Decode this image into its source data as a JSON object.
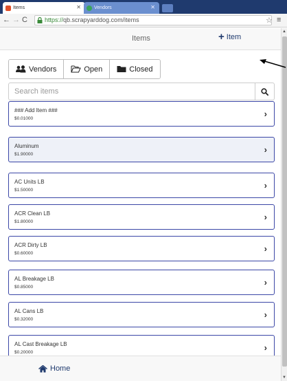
{
  "browser": {
    "tabs": [
      {
        "title": "Items"
      },
      {
        "title": "Vendors"
      }
    ],
    "url_scheme": "https://",
    "url_rest": "qb.scrapyarddog.com/items"
  },
  "header": {
    "title": "Items",
    "add_label": "Item"
  },
  "filters": {
    "vendors_label": "Vendors",
    "open_label": "Open",
    "closed_label": "Closed"
  },
  "search": {
    "placeholder": "Search items"
  },
  "items": [
    {
      "name": "### Add Item ###",
      "price": "$0.01000"
    },
    {
      "name": "Aluminum",
      "price": "$1.90000"
    },
    {
      "name": "AC Units LB",
      "price": "$1.50000"
    },
    {
      "name": "ACR Clean LB",
      "price": "$1.80000"
    },
    {
      "name": "ACR Dirty LB",
      "price": "$0.60000"
    },
    {
      "name": "AL Breakage LB",
      "price": "$0.85000"
    },
    {
      "name": "AL Cans LB",
      "price": "$0.32000"
    },
    {
      "name": "AL Cast Breakage LB",
      "price": "$0.20000"
    }
  ],
  "footer": {
    "home_label": "Home"
  },
  "colors": {
    "accent": "#1f3a6e",
    "item_border": "#3a46a6",
    "highlight_row": "#eef1f8"
  }
}
